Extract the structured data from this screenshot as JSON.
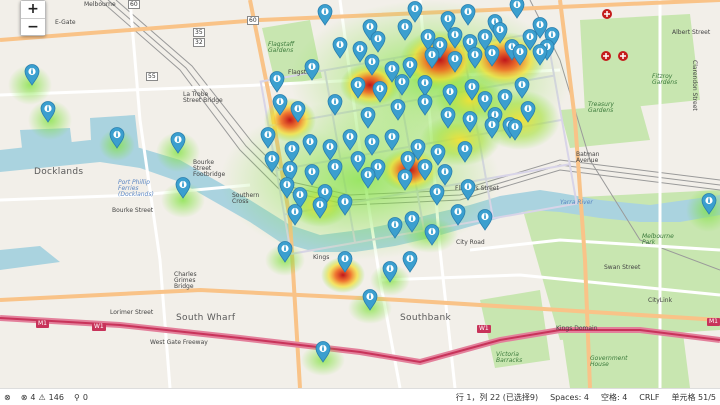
{
  "map": {
    "zoom_in": "+",
    "zoom_out": "−",
    "districts": [
      {
        "name": "Docklands"
      },
      {
        "name": "South Wharf"
      },
      {
        "name": "Southbank"
      }
    ],
    "roads": [
      {
        "name": "Melbourne"
      },
      {
        "name": "E-Gate"
      },
      {
        "name": "La Trobe Street Bridge"
      },
      {
        "name": "Bourke Street Footbridge"
      },
      {
        "name": "Southern Cross"
      },
      {
        "name": "Charles Grimes Bridge"
      },
      {
        "name": "Lorimer Street"
      },
      {
        "name": "West Gate Freeway"
      },
      {
        "name": "Albert Street"
      },
      {
        "name": "Batman Avenue"
      },
      {
        "name": "Swan Street"
      },
      {
        "name": "CityLink"
      },
      {
        "name": "Kings Domain"
      },
      {
        "name": "Bourke Street"
      },
      {
        "name": "Flinders Street"
      },
      {
        "name": "Flagstaff"
      },
      {
        "name": "Kings"
      },
      {
        "name": "Clarendon Street"
      },
      {
        "name": "City Road"
      }
    ],
    "parks": [
      {
        "name": "Flagstaff Gardens"
      },
      {
        "name": "Fitzroy Gardens"
      },
      {
        "name": "Treasury Gardens"
      },
      {
        "name": "Melbourne Park"
      },
      {
        "name": "Government House"
      },
      {
        "name": "Victoria Barracks"
      }
    ],
    "waters": [
      {
        "name": "Port Phillip Ferries (Docklands)"
      },
      {
        "name": "Yarra River"
      }
    ],
    "shields": [
      "60",
      "55",
      "35",
      "32",
      "60",
      "M1",
      "W1",
      "W1",
      "M1"
    ],
    "marker_color": "#3b9fcf",
    "heat_colors": {
      "low": "#7ee23a",
      "mid": "#f5e02c",
      "high": "#e8321e"
    }
  },
  "statusbar": {
    "remote": "⊗",
    "errors": "4",
    "warnings": "146",
    "ports": "0",
    "cursor": "行 1，列 22 (已选择9)",
    "spaces": "Spaces: 4",
    "spaces_cn": "空格: 4",
    "eol": "CRLF",
    "cell": "单元格 51/5"
  }
}
